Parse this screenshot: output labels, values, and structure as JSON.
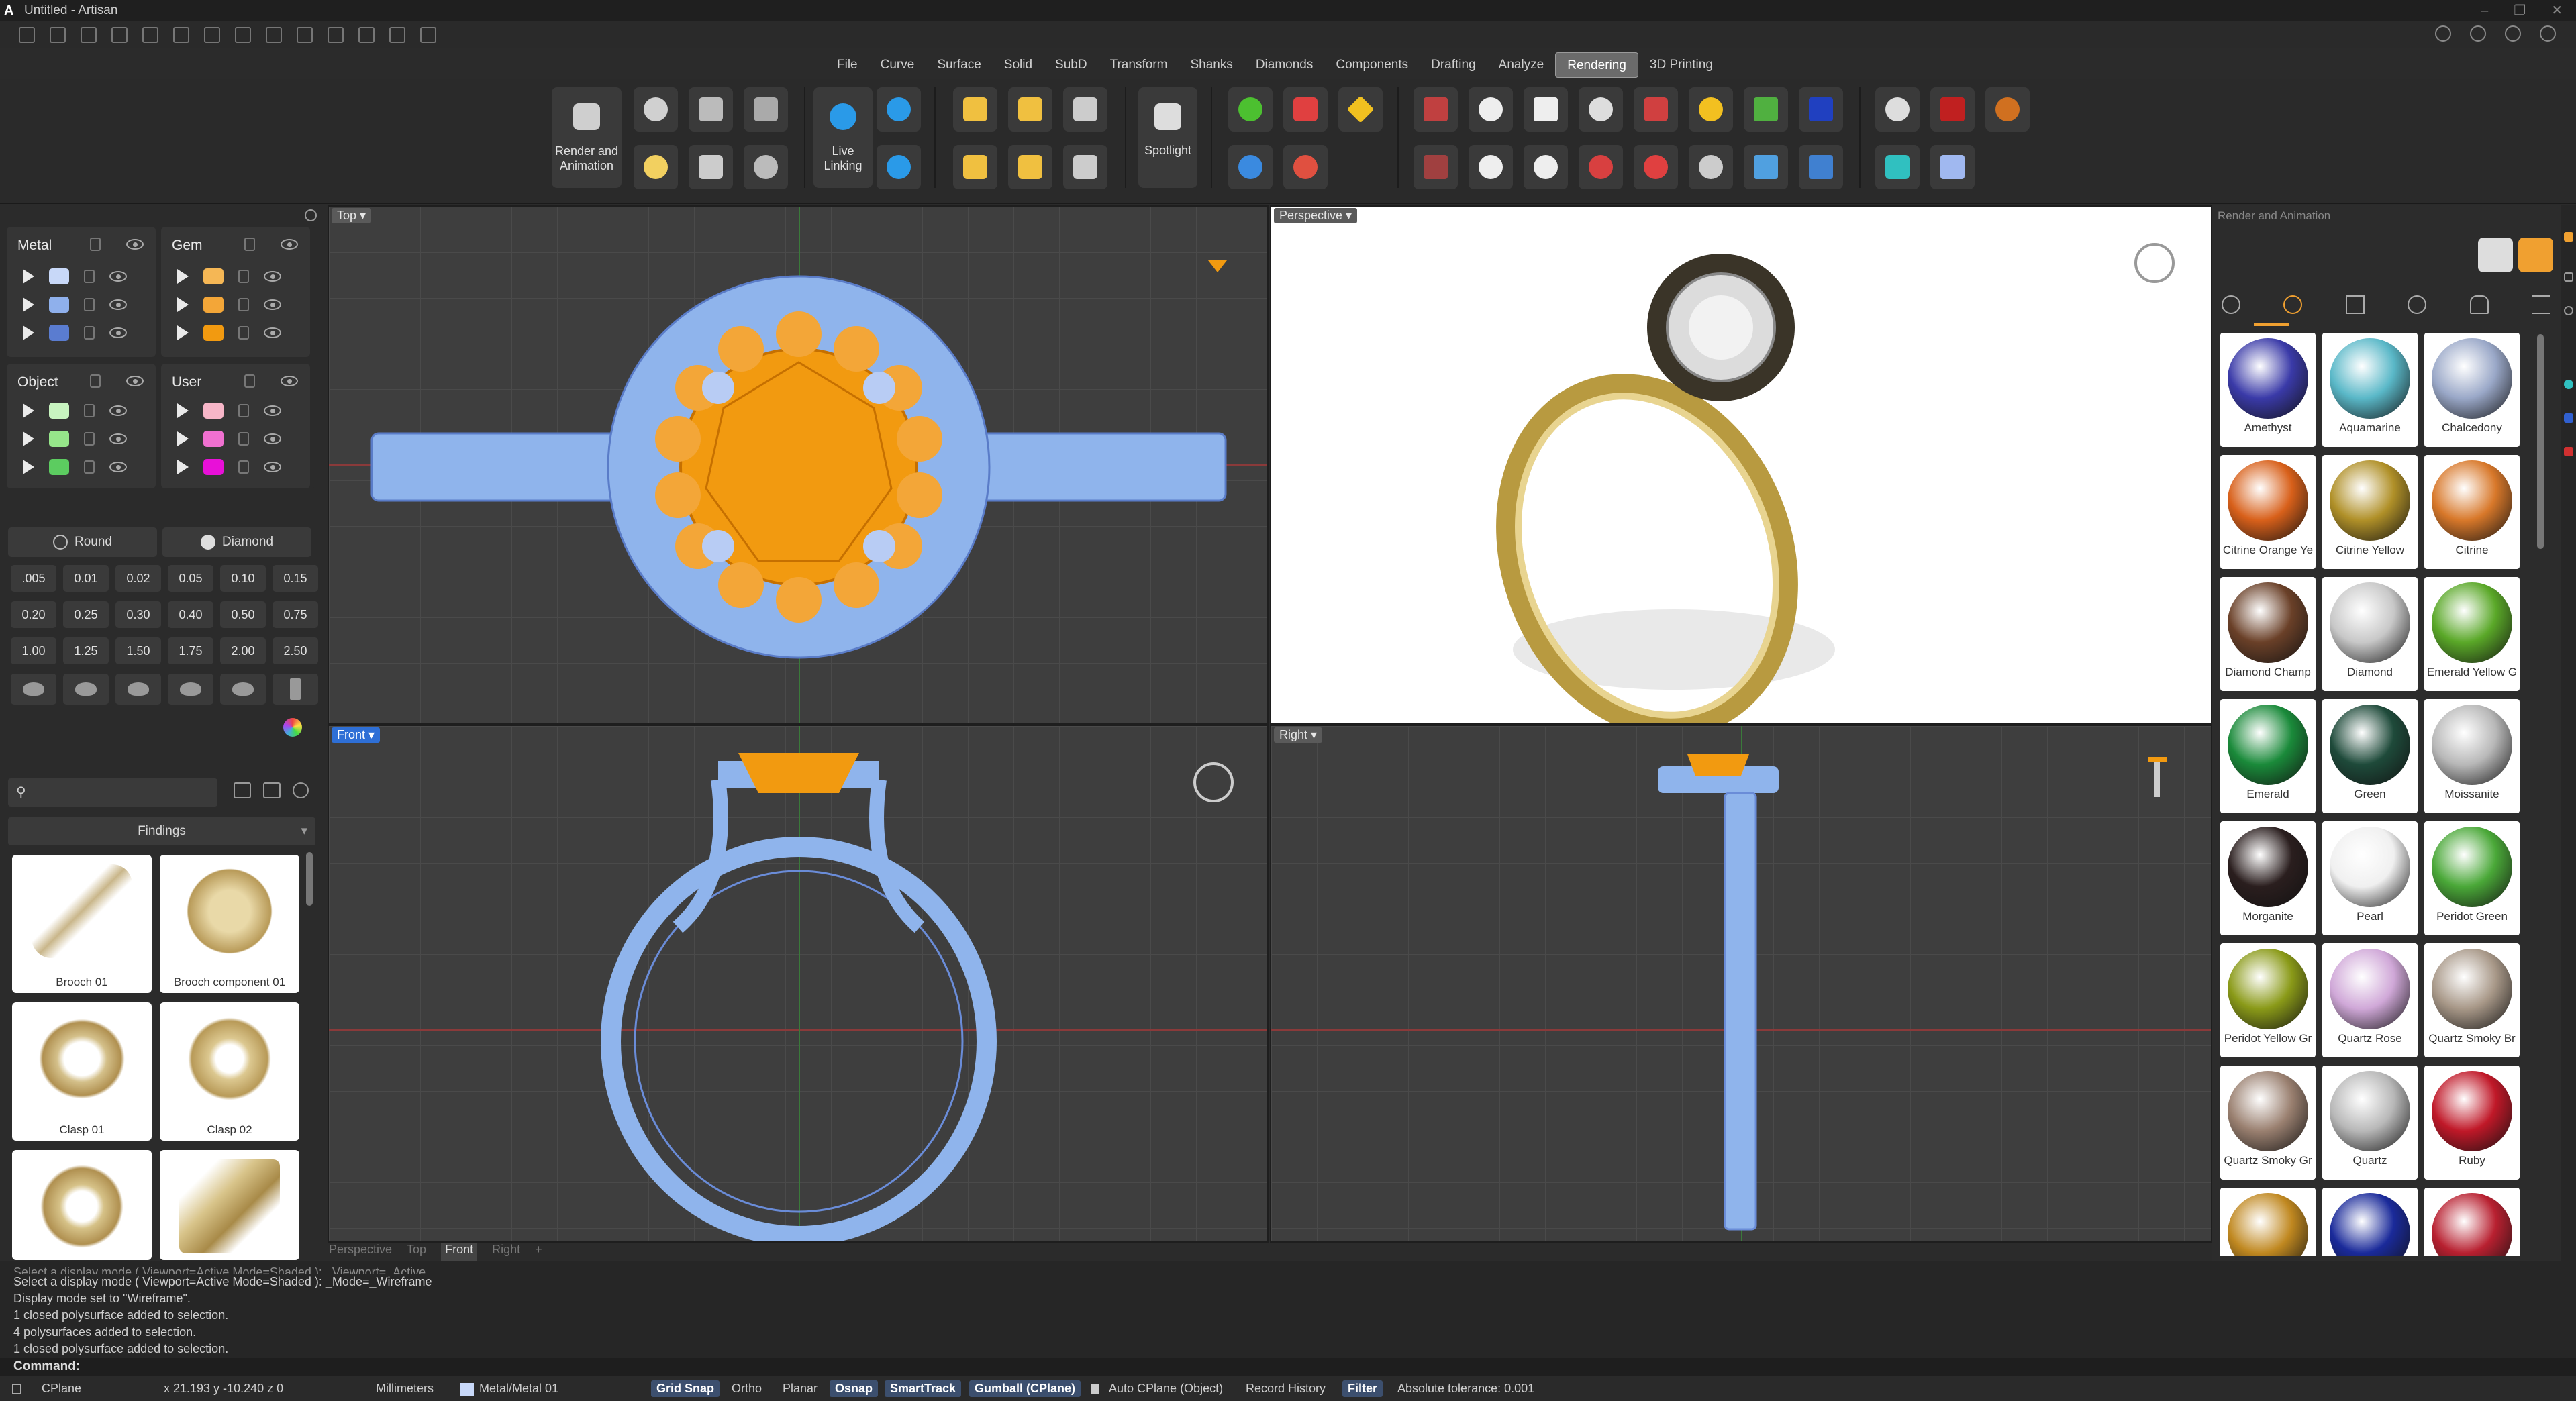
{
  "window": {
    "title": "Untitled - Artisan",
    "logo": "A"
  },
  "menu": [
    "File",
    "Curve",
    "Surface",
    "Solid",
    "SubD",
    "Transform",
    "Shanks",
    "Diamonds",
    "Components",
    "Drafting",
    "Analyze",
    "Rendering",
    "3D Printing"
  ],
  "menu_active": "Rendering",
  "ribbon": {
    "render_animation_label": "Render and Animation",
    "live_linking_label": "Live Linking",
    "spotlight_label": "Spotlight"
  },
  "layers": {
    "metal": "Metal",
    "gem": "Gem",
    "object": "Object",
    "user": "User",
    "colors": {
      "metal": [
        "#c8d8f8",
        "#8fb0ec",
        "#5a7cd0"
      ],
      "gem": [
        "#f5b755",
        "#f3a638",
        "#f29a10"
      ],
      "object": [
        "#c8f4c0",
        "#96e68a",
        "#5ccc60"
      ],
      "user": [
        "#f7b6c8",
        "#f070d0",
        "#e810d8"
      ]
    }
  },
  "stone_shape": {
    "round": "Round",
    "diamond": "Diamond"
  },
  "sizes": [
    ".005",
    "0.01",
    "0.02",
    "0.05",
    "0.10",
    "0.15",
    "0.20",
    "0.25",
    "0.30",
    "0.40",
    "0.50",
    "0.75",
    "1.00",
    "1.25",
    "1.50",
    "1.75",
    "2.00",
    "2.50"
  ],
  "findings": {
    "search_placeholder": "",
    "category": "Findings",
    "items": [
      "Brooch 01",
      "Brooch component 01",
      "Clasp 01",
      "Clasp 02",
      "",
      ""
    ]
  },
  "viewports": {
    "top": "Top",
    "perspective": "Perspective",
    "front": "Front",
    "right": "Right"
  },
  "viewport_tabs": [
    "Perspective",
    "Top",
    "Front",
    "Right",
    "+"
  ],
  "command_history": [
    "Select a display mode ( Viewport=Active  Mode=Shaded ): _Viewport=_Active",
    "Select a display mode ( Viewport=Active  Mode=Shaded ): _Mode=_Wireframe",
    "Display mode set to \"Wireframe\".",
    "1 closed polysurface added to selection.",
    "4 polysurfaces added to selection.",
    "1 closed polysurface added to selection."
  ],
  "command_prompt": "Command:",
  "status": {
    "cplane": "CPlane",
    "coords": "x 21.193  y -10.240  z 0",
    "units": "Millimeters",
    "layer": "Metal/Metal 01",
    "grid_snap": "Grid Snap",
    "ortho": "Ortho",
    "planar": "Planar",
    "osnap": "Osnap",
    "smarttrack": "SmartTrack",
    "gumball": "Gumball (CPlane)",
    "auto_cplane": "Auto CPlane (Object)",
    "record_history": "Record History",
    "filter": "Filter",
    "tolerance": "Absolute tolerance: 0.001"
  },
  "right_panel": {
    "title": "Render and Animation",
    "materials": [
      {
        "name": "Amethyst",
        "color": "#3a3aa8"
      },
      {
        "name": "Aquamarine",
        "color": "#5ab8c8"
      },
      {
        "name": "Chalcedony",
        "color": "#9aa8c8"
      },
      {
        "name": "Citrine Orange Ye",
        "color": "#d8601a"
      },
      {
        "name": "Citrine Yellow",
        "color": "#b09028"
      },
      {
        "name": "Citrine",
        "color": "#d8782a"
      },
      {
        "name": "Diamond Champ",
        "color": "#6a4028"
      },
      {
        "name": "Diamond",
        "color": "#c8c8c8"
      },
      {
        "name": "Emerald Yellow G",
        "color": "#5aa828"
      },
      {
        "name": "Emerald",
        "color": "#1a8a3a"
      },
      {
        "name": "Green",
        "color": "#1e4a3a"
      },
      {
        "name": "Moissanite",
        "color": "#b8b8b8"
      },
      {
        "name": "Morganite",
        "color": "#2a1e1e"
      },
      {
        "name": "Pearl",
        "color": "#f0f0f0"
      },
      {
        "name": "Peridot Green",
        "color": "#4aa838"
      },
      {
        "name": "Peridot Yellow Gr",
        "color": "#8a9a18"
      },
      {
        "name": "Quartz Rose",
        "color": "#d0a8d8"
      },
      {
        "name": "Quartz Smoky Br",
        "color": "#a89888"
      },
      {
        "name": "Quartz Smoky Gr",
        "color": "#9a8070"
      },
      {
        "name": "Quartz",
        "color": "#b8b8b8"
      },
      {
        "name": "Ruby",
        "color": "#c01828"
      },
      {
        "name": "",
        "color": "#c08820"
      },
      {
        "name": "",
        "color": "#1a2a9a"
      },
      {
        "name": "",
        "color": "#b82030"
      }
    ]
  }
}
